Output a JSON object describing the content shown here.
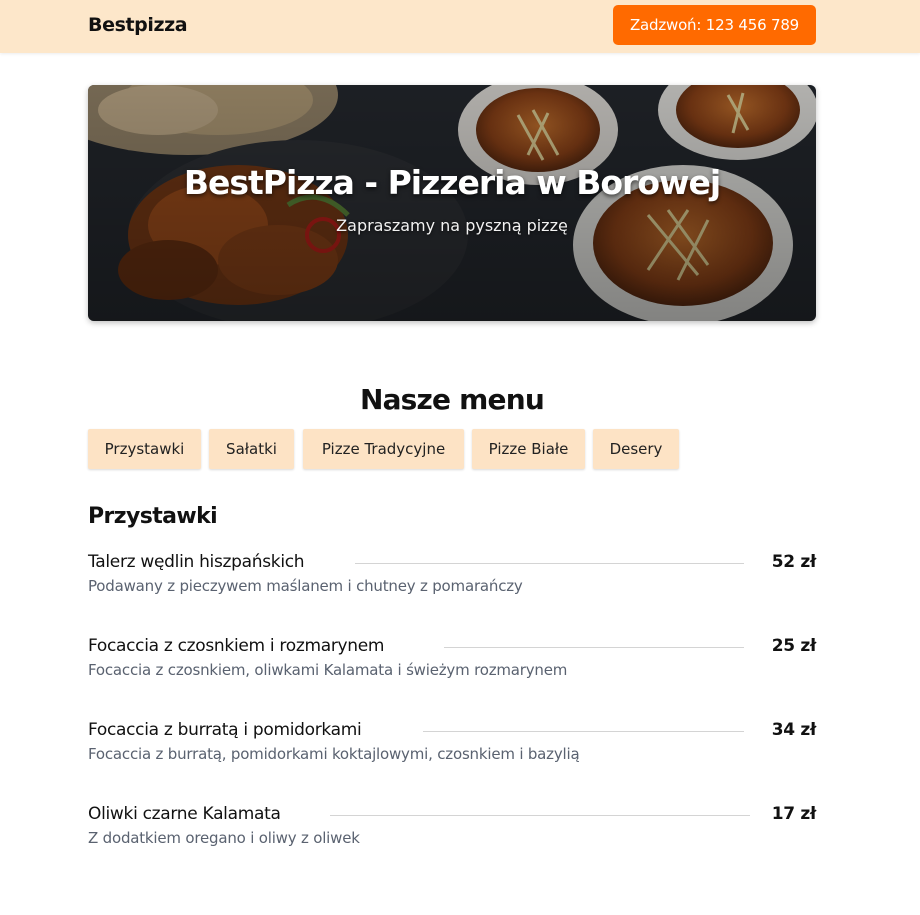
{
  "header": {
    "logo": "Bestpizza",
    "call_button": "Zadzwoń: 123 456 789"
  },
  "hero": {
    "title": "BestPizza - Pizzeria w Borowej",
    "subtitle": "Zapraszamy na pyszną pizzę"
  },
  "menu": {
    "title": "Nasze menu",
    "tabs": [
      {
        "label": "Przystawki"
      },
      {
        "label": "Sałatki"
      },
      {
        "label": "Pizze Tradycyjne"
      },
      {
        "label": "Pizze Białe"
      },
      {
        "label": "Desery"
      }
    ]
  },
  "section": {
    "title": "Przystawki",
    "items": [
      {
        "name": "Talerz wędlin hiszpańskich",
        "description": "Podawany z pieczywem maślanem i chutney z pomarańczy",
        "price": "52 zł"
      },
      {
        "name": "Focaccia z czosnkiem i rozmarynem",
        "description": "Focaccia z czosnkiem, oliwkami Kalamata i świeżym rozmarynem",
        "price": "25 zł"
      },
      {
        "name": "Focaccia z burratą i pomidorkami",
        "description": "Focaccia z burratą, pomidorkami koktajlowymi, czosnkiem i bazylią",
        "price": "34 zł"
      },
      {
        "name": "Oliwki czarne Kalamata",
        "description": "Z dodatkiem oregano i oliwy z oliwek",
        "price": "17 zł"
      }
    ]
  },
  "colors": {
    "header_bg": "#fde7ca",
    "accent": "#ff6a00",
    "tab_bg": "#fde3c5",
    "description_text": "#5a6270"
  }
}
